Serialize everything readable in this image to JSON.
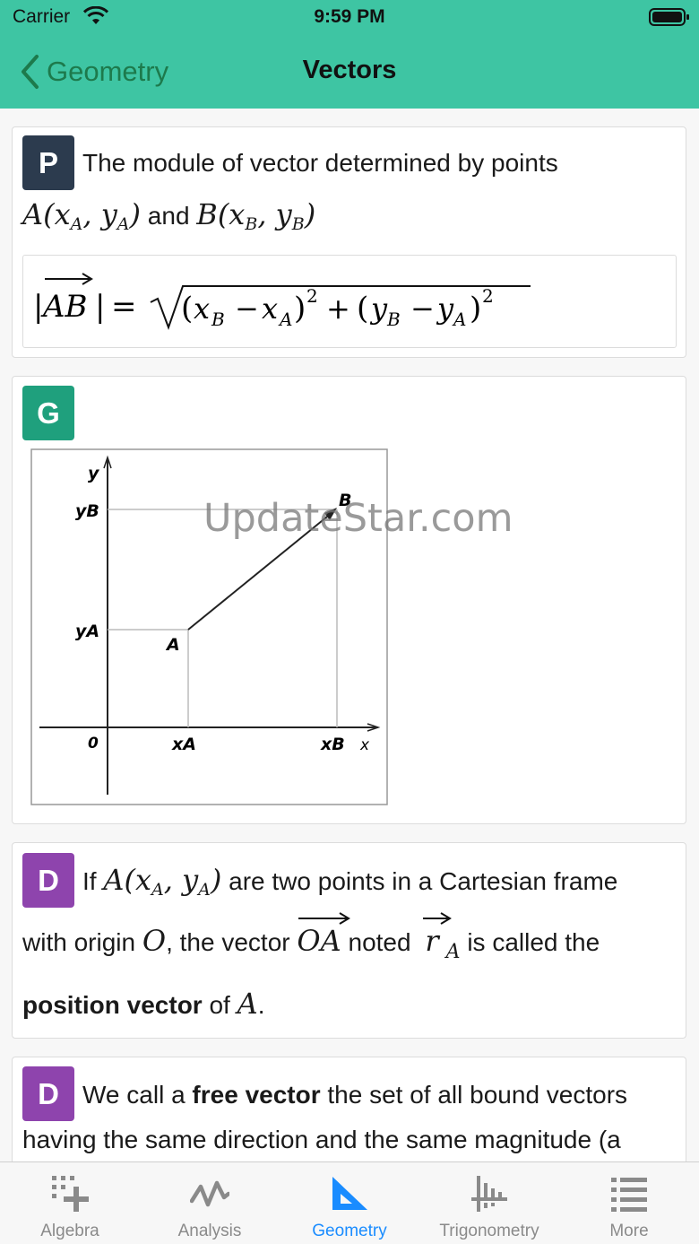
{
  "status_bar": {
    "carrier": "Carrier",
    "time": "9:59 PM"
  },
  "nav": {
    "back_label": "Geometry",
    "title": "Vectors"
  },
  "cards": {
    "property": {
      "badge": "P",
      "line1": "The module of vector determined by points",
      "and_word": "and",
      "formula": "|AB| = √((x_B − x_A)² + (y_B − y_A)²)"
    },
    "graph": {
      "badge": "G",
      "labels": {
        "y_axis": "y",
        "x_axis": "x",
        "yB": "yB",
        "yA": "yA",
        "origin": "0",
        "xA": "xA",
        "xB": "xB",
        "pointA": "A",
        "pointB": "B"
      }
    },
    "definition1": {
      "badge": "D",
      "if_word": "If",
      "line1_rest": "are two points in a Cartesian frame",
      "line2_start": "with origin",
      "line2_mid": ", the vector",
      "noted": "noted",
      "is_called": "is called the",
      "term": "position vector",
      "of_word": "of"
    },
    "definition2": {
      "badge": "D",
      "line1_a": "We call a",
      "term": "free vector",
      "line1_b": "the set of all bound vectors",
      "line2": "having the same direction and the same magnitude (a"
    }
  },
  "watermark": "UpdateStar.com",
  "tabs": [
    {
      "label": "Algebra",
      "icon": "algebra-icon"
    },
    {
      "label": "Analysis",
      "icon": "analysis-icon"
    },
    {
      "label": "Geometry",
      "icon": "geometry-icon",
      "active": true
    },
    {
      "label": "Trigonometry",
      "icon": "trigonometry-icon"
    },
    {
      "label": "More",
      "icon": "more-icon"
    }
  ],
  "colors": {
    "header": "#3ec5a3",
    "back": "#1d7a4c",
    "active_tab": "#1a8cff",
    "badge_p": "#2c3b4e",
    "badge_g": "#1fa07d",
    "badge_d": "#8e44ad"
  }
}
